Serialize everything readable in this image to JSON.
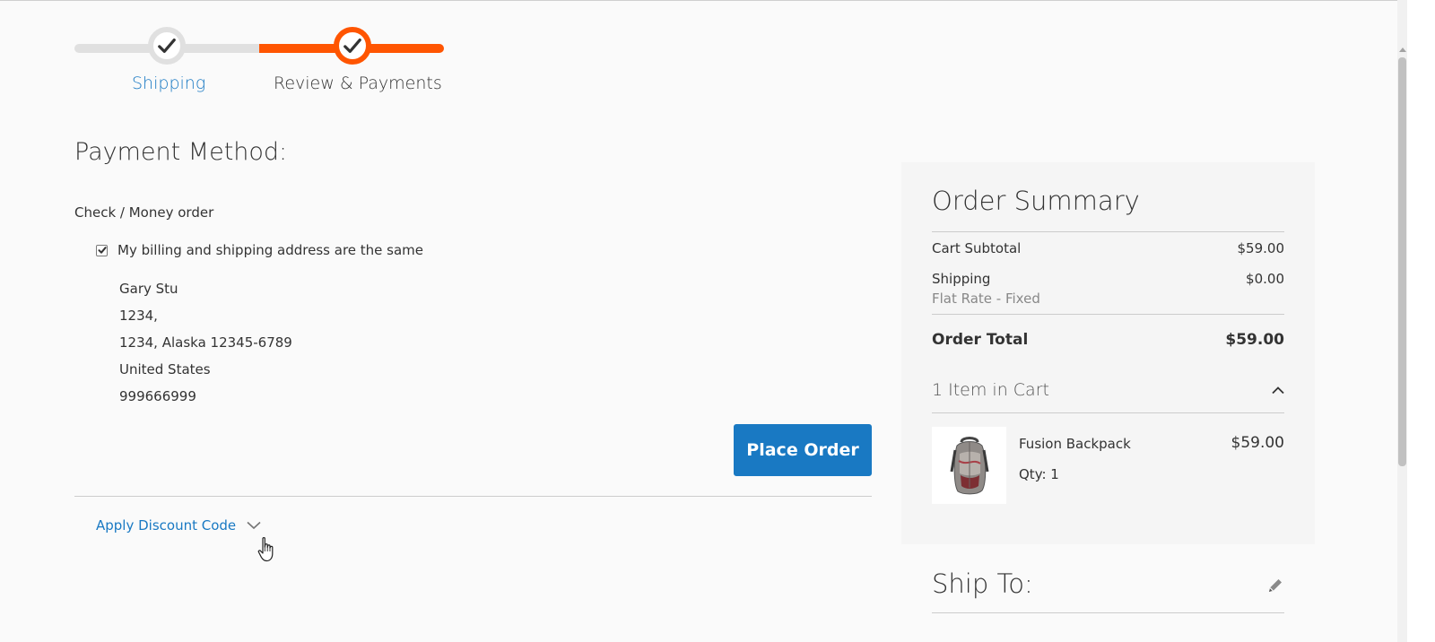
{
  "progress": {
    "steps": [
      {
        "label": "Shipping",
        "state": "complete"
      },
      {
        "label": "Review & Payments",
        "state": "active"
      }
    ],
    "colors": {
      "complete": "#e0e0e0",
      "active": "#ff5501",
      "link": "#1979c3"
    }
  },
  "payment": {
    "title": "Payment Method:",
    "method": "Check / Money order",
    "same_address_label": "My billing and shipping address are the same",
    "same_address_checked": true,
    "address_lines": [
      "Gary Stu",
      "1234,",
      "1234, Alaska 12345-6789",
      "United States",
      "999666999"
    ],
    "place_order_label": "Place Order",
    "discount_label": "Apply Discount Code"
  },
  "summary": {
    "title": "Order Summary",
    "subtotal_label": "Cart Subtotal",
    "subtotal_value": "$59.00",
    "shipping_label": "Shipping",
    "shipping_method": "Flat Rate - Fixed",
    "shipping_value": "$0.00",
    "total_label": "Order Total",
    "total_value": "$59.00",
    "items_label": "1 Item in Cart",
    "item": {
      "name": "Fusion Backpack",
      "qty": "Qty: 1",
      "price": "$59.00"
    }
  },
  "ship_to": {
    "title": "Ship To:"
  },
  "icons": [
    "check-icon",
    "chevron-down-icon",
    "chevron-up-icon",
    "pencil-icon",
    "hand-cursor-icon",
    "backpack-image"
  ]
}
